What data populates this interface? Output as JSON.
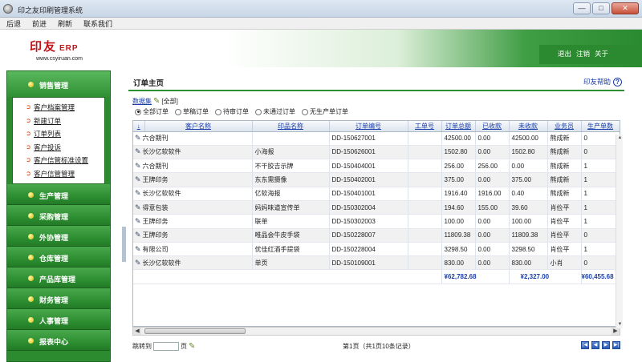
{
  "window": {
    "title": "印之友印刷管理系统",
    "buttons": [
      "—",
      "□",
      "✕"
    ]
  },
  "menu": {
    "items": [
      "后退",
      "前进",
      "刷新",
      "联系我们"
    ]
  },
  "header": {
    "logo_text": "印友",
    "logo_erp": "ERP",
    "logo_url": "www.csyiruan.com",
    "links": [
      "退出",
      "注销",
      "关于"
    ]
  },
  "sidebar": {
    "active_section": "销售管理",
    "sub_items": [
      "客户档案管理",
      "新建订单",
      "订单列表",
      "客户投诉",
      "客户信管标准设置",
      "客户信管管理"
    ],
    "sections": [
      "生产管理",
      "采购管理",
      "外协管理",
      "仓库管理",
      "产品库管理",
      "财务管理",
      "人事管理",
      "报表中心"
    ]
  },
  "main": {
    "title": "订单主页",
    "help": "印友帮助",
    "dataset_label": "数据集",
    "dataset_value": "[全部]",
    "filters": [
      {
        "label": "全部订单",
        "checked": true
      },
      {
        "label": "草稿订单",
        "checked": false
      },
      {
        "label": "待审订单",
        "checked": false
      },
      {
        "label": "未通过订单",
        "checked": false
      },
      {
        "label": "无生产单订单",
        "checked": false
      }
    ],
    "table": {
      "sort_indicator": "↓",
      "columns": [
        "客户名称",
        "印品名称",
        "订单编号",
        "工单号",
        "订单总额",
        "已收款",
        "未收款",
        "业务员",
        "生产单数"
      ],
      "rows": [
        [
          "六合期刊",
          "",
          "DD-150627001",
          "",
          "42500.00",
          "0.00",
          "42500.00",
          "熊成新",
          "0"
        ],
        [
          "长沙亿软软件",
          "小海报",
          "DD-150626001",
          "",
          "1502.80",
          "0.00",
          "1502.80",
          "熊成新",
          "0"
        ],
        [
          "六合期刊",
          "不干胶吉示牌",
          "DD-150404001",
          "",
          "256.00",
          "256.00",
          "0.00",
          "熊成新",
          "1"
        ],
        [
          "王牌印务",
          "东东需摄像",
          "DD-150402001",
          "",
          "375.00",
          "0.00",
          "375.00",
          "熊成新",
          "1"
        ],
        [
          "长沙亿软软件",
          "亿软海报",
          "DD-150401001",
          "",
          "1916.40",
          "1916.00",
          "0.40",
          "熊成新",
          "1"
        ],
        [
          "得意包装",
          "妈妈味道宣传单",
          "DD-150302004",
          "",
          "194.60",
          "155.00",
          "39.60",
          "肖俭平",
          "1"
        ],
        [
          "王牌印务",
          "联单",
          "DD-150302003",
          "",
          "100.00",
          "0.00",
          "100.00",
          "肖俭平",
          "1"
        ],
        [
          "王牌印务",
          "唯品会牛皮手袋",
          "DD-150228007",
          "",
          "11809.38",
          "0.00",
          "11809.38",
          "肖俭平",
          "0"
        ],
        [
          "有限公司",
          "优佳红酒手提袋",
          "DD-150228004",
          "",
          "3298.50",
          "0.00",
          "3298.50",
          "肖俭平",
          "1"
        ],
        [
          "长沙亿软软件",
          "单页",
          "DD-150109001",
          "",
          "830.00",
          "0.00",
          "830.00",
          "小肖",
          "0"
        ]
      ],
      "totals": {
        "total": "¥62,782.68",
        "received": "¥2,327.00",
        "unreceived": "¥60,455.68"
      }
    },
    "pager": {
      "jump_label": "跳转到",
      "page_suffix": "页",
      "info": "第1页（共1页10条记录）",
      "nav": [
        "|◀",
        "◀",
        "▶",
        "▶|"
      ]
    }
  }
}
